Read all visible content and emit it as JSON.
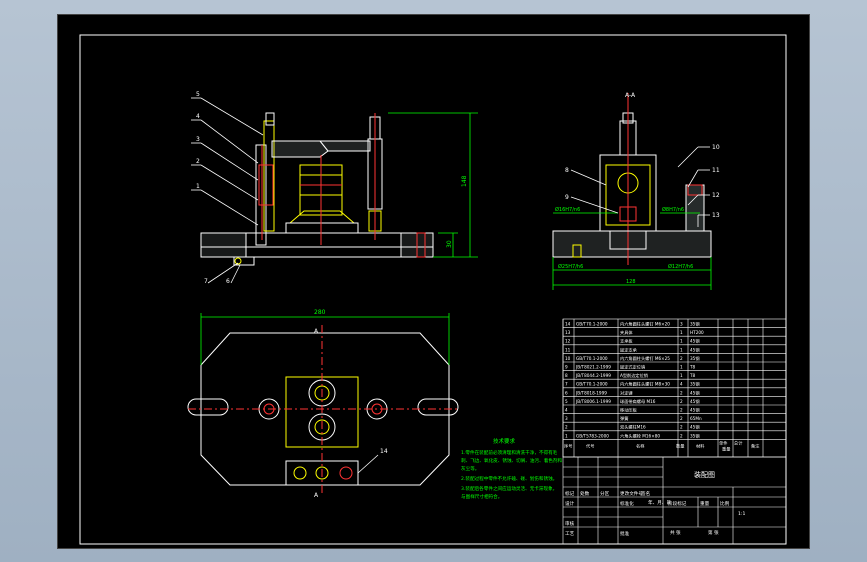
{
  "views": {
    "front_balloons": [
      "5",
      "4",
      "3",
      "2",
      "1",
      "7",
      "6"
    ],
    "dim_height_total": "148",
    "dim_height_base": "30",
    "section_label": "A-A",
    "side_balloons": [
      "10",
      "11",
      "12",
      "13",
      "8",
      "9"
    ],
    "side_note_left": "Ø16H7/n6",
    "side_note_right": "Ø8H7/n6",
    "side_bottom_left": "Ø25H7/h6",
    "side_bottom_right": "Ø12H7/h6",
    "side_bottom_dim": "128",
    "plan_width_dim": "280",
    "plan_section_top": "A",
    "plan_section_bottom": "A",
    "plan_balloon": "14"
  },
  "notes": {
    "title": "技术要求",
    "lines": [
      "1.零件在装配前必须清理和清洗干净，不得有毛",
      "刺、飞边、氧化皮、锈蚀、切屑、油污、着色剂和",
      "灰尘等。",
      "2.装配过程中零件不允许磕、碰、划伤和锈蚀。",
      "3.装配后各零件之间应运动灵活、无卡滞现象，",
      "与图样尺寸相符合。"
    ]
  },
  "bom": {
    "rows": [
      {
        "no": "14",
        "code": "GB/T70.1-2000",
        "name": "内六角圆柱头螺钉 M6×20",
        "qty": "3",
        "mat": "35钢"
      },
      {
        "no": "13",
        "code": "",
        "name": "夹具体",
        "qty": "1",
        "mat": "HT200"
      },
      {
        "no": "12",
        "code": "",
        "name": "支承板",
        "qty": "1",
        "mat": "45钢"
      },
      {
        "no": "11",
        "code": "",
        "name": "固定支承",
        "qty": "1",
        "mat": "45钢"
      },
      {
        "no": "10",
        "code": "GB/T70.1-2000",
        "name": "内六角圆柱头螺钉 M6×25",
        "qty": "2",
        "mat": "35钢"
      },
      {
        "no": "9",
        "code": "JB/T8021.2-1999",
        "name": "固定式定位销",
        "qty": "1",
        "mat": "T8"
      },
      {
        "no": "8",
        "code": "JB/T8044.2-1999",
        "name": "A型削边定位销",
        "qty": "1",
        "mat": "T8"
      },
      {
        "no": "7",
        "code": "GB/T70.1-2000",
        "name": "内六角圆柱头螺钉 M8×30",
        "qty": "4",
        "mat": "35钢"
      },
      {
        "no": "6",
        "code": "JB/T8018-1999",
        "name": "对定键",
        "qty": "2",
        "mat": "45钢"
      },
      {
        "no": "5",
        "code": "JB/T8006.1-1999",
        "name": "球面带肩螺母 M16",
        "qty": "2",
        "mat": "45钢"
      },
      {
        "no": "4",
        "code": "",
        "name": "移动压板",
        "qty": "2",
        "mat": "45钢"
      },
      {
        "no": "3",
        "code": "",
        "name": "弹簧",
        "qty": "2",
        "mat": "65Mn"
      },
      {
        "no": "2",
        "code": "",
        "name": "双头螺柱M16",
        "qty": "2",
        "mat": "45钢"
      },
      {
        "no": "1",
        "code": "GB/T5783-2000",
        "name": "六角头螺栓 M16×80",
        "qty": "2",
        "mat": "35钢"
      }
    ],
    "header": {
      "no": "序号",
      "code": "代号",
      "name": "名称",
      "qty": "数量",
      "mat": "材料",
      "unit_weight": "单件",
      "total_weight": "总计",
      "weight_label": "重量",
      "remark": "备注"
    }
  },
  "titleblock": {
    "drawing_name": "装配图",
    "rows_labels": [
      "标记",
      "处数",
      "分区",
      "更改文件号",
      "签名",
      "年、月、日"
    ],
    "design": "设计",
    "standardize": "标准化",
    "review": "审核",
    "process": "工艺",
    "approve": "批准",
    "stage_label": "阶段标记",
    "weight": "重量",
    "scale": "比例",
    "sheets_total": "共  张",
    "sheet_no": "第  张",
    "scale_value": "1:1"
  }
}
